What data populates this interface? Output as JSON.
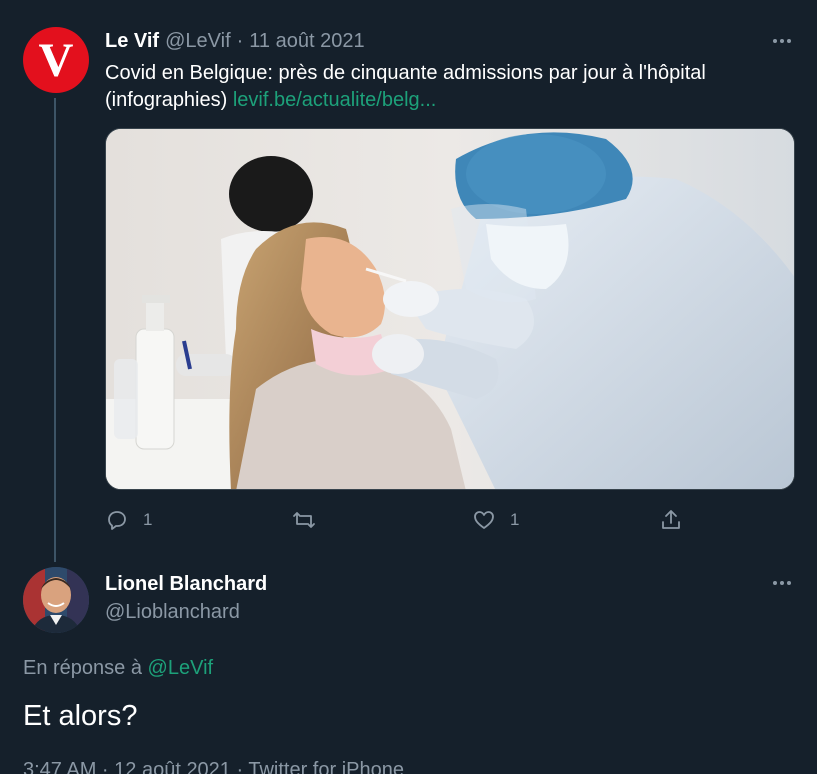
{
  "tweet": {
    "author_name": "Le Vif",
    "author_handle": "@LeVif",
    "separator": "·",
    "date": "11 août 2021",
    "avatar_letter": "V",
    "text": "Covid en Belgique: près de cinquante admissions par jour à l'hôpital (infographies)",
    "link": "levif.be/actualite/belg...",
    "actions": {
      "reply_count": "1",
      "retweet_count": "",
      "like_count": "1"
    }
  },
  "reply": {
    "author_name": "Lionel Blanchard",
    "author_handle": "@Lioblanchard",
    "in_reply_prefix": "En réponse à",
    "in_reply_handle": "@LeVif",
    "text": "Et alors?",
    "meta": "3:47 AM · 12 août 2021 · Twitter for iPhone"
  },
  "colors": {
    "background": "#15202b",
    "accent_link": "#1da17a",
    "muted": "#8b98a5",
    "brand_red": "#e3101d"
  },
  "icons": [
    "more-icon",
    "reply-icon",
    "retweet-icon",
    "like-icon",
    "share-icon"
  ]
}
